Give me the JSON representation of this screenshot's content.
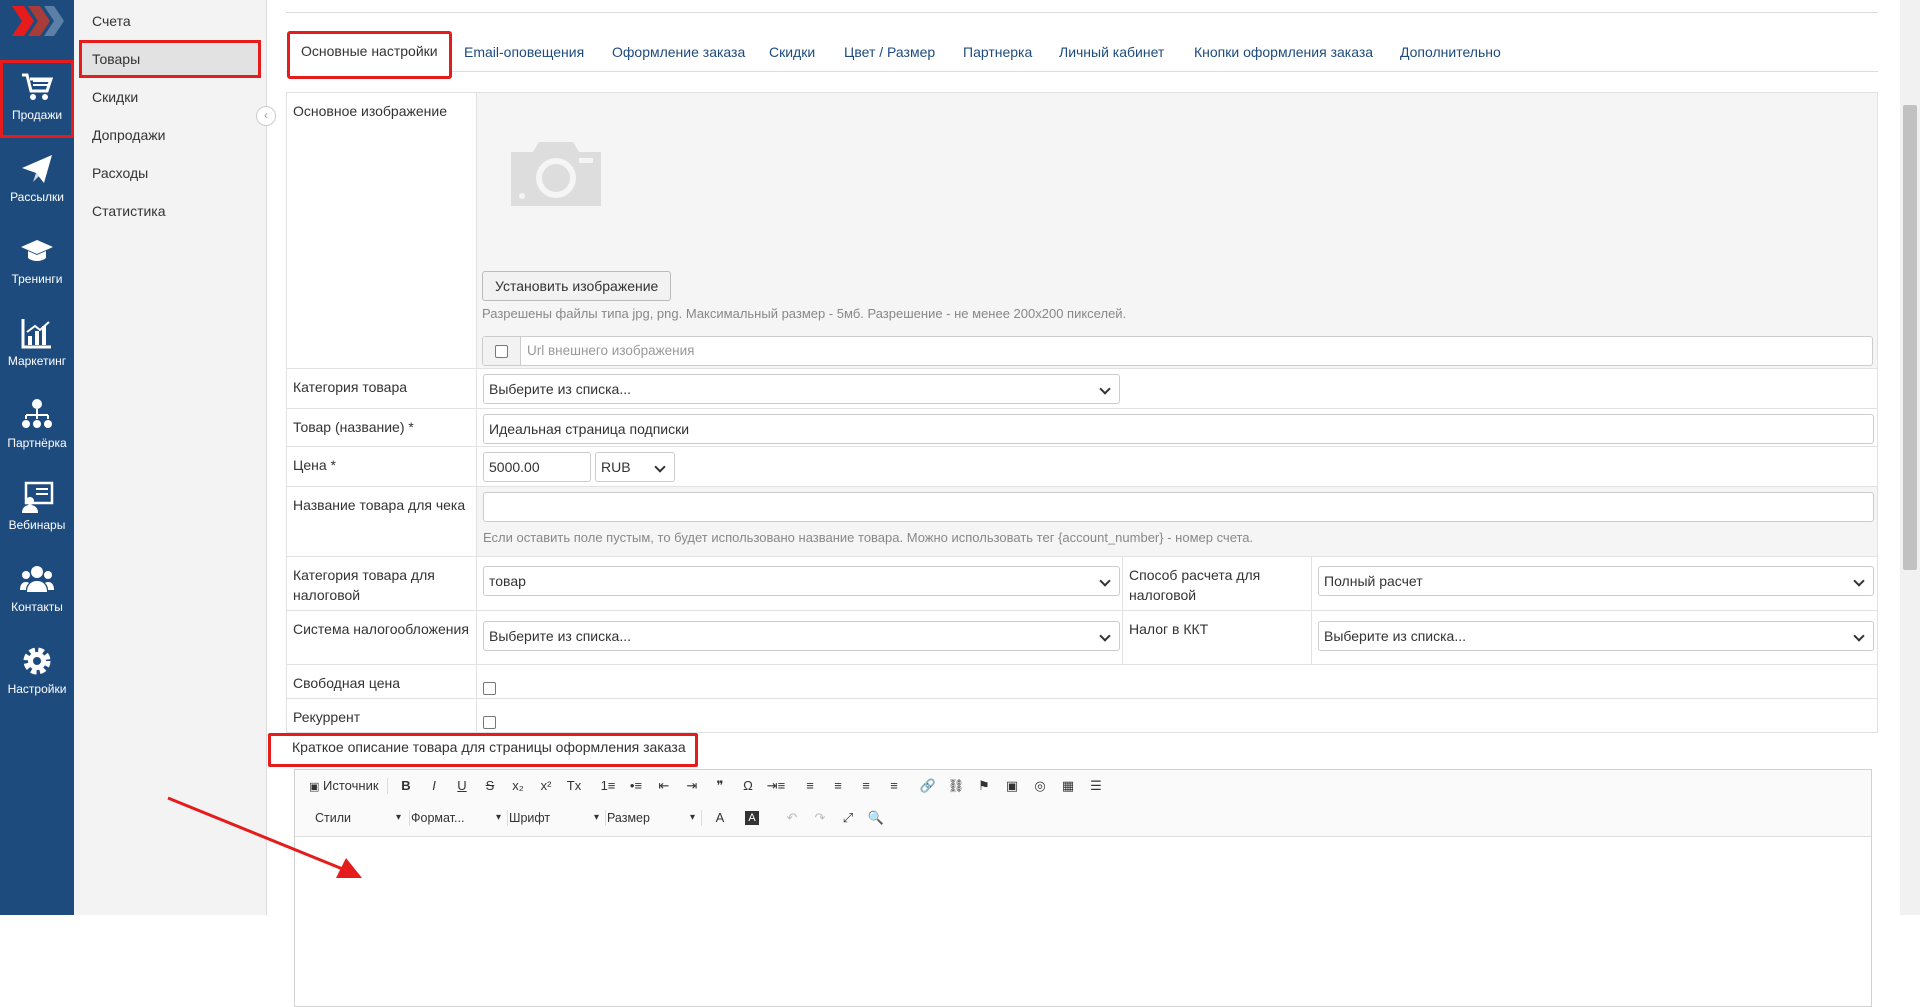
{
  "rail": {
    "items": [
      {
        "label": "Продажи",
        "icon": "cart-icon"
      },
      {
        "label": "Рассылки",
        "icon": "paper-plane-icon"
      },
      {
        "label": "Тренинги",
        "icon": "graduation-cap-icon"
      },
      {
        "label": "Маркетинг",
        "icon": "chart-icon"
      },
      {
        "label": "Партнёрка",
        "icon": "sitemap-icon"
      },
      {
        "label": "Вебинары",
        "icon": "webinar-icon"
      },
      {
        "label": "Контакты",
        "icon": "users-icon"
      },
      {
        "label": "Настройки",
        "icon": "gear-icon"
      }
    ]
  },
  "subnav": {
    "items": [
      "Счета",
      "Товары",
      "Скидки",
      "Допродажи",
      "Расходы",
      "Статистика"
    ]
  },
  "tabs": [
    "Основные настройки",
    "Email-оповещения",
    "Оформление заказа",
    "Скидки",
    "Цвет / Размер",
    "Партнерка",
    "Личный кабинет",
    "Кнопки оформления заказа",
    "Дополнительно"
  ],
  "form": {
    "image": {
      "label": "Основное изображение",
      "button": "Установить изображение",
      "hint": "Разрешены файлы типа jpg, png. Максимальный размер - 5мб. Разрешение - не менее 200x200 пикселей.",
      "url_placeholder": "Url внешнего изображения"
    },
    "category": {
      "label": "Категория товара",
      "value": "Выберите из списка..."
    },
    "name": {
      "label": "Товар (название) *",
      "value": "Идеальная страница подписки"
    },
    "price": {
      "label": "Цена *",
      "value": "5000.00",
      "currency": "RUB"
    },
    "receipt_name": {
      "label": "Название товара для чека",
      "value": "",
      "hint": "Если оставить поле пустым, то будет использовано название товара. Можно использовать тег {account_number} - номер счета."
    },
    "tax_category": {
      "label": "Категория товара для налоговой",
      "value": "товар"
    },
    "payment_method": {
      "label": "Способ расчета для налоговой",
      "value": "Полный расчет"
    },
    "tax_system": {
      "label": "Система налогообложения",
      "value": "Выберите из списка..."
    },
    "kkt_tax": {
      "label": "Налог в ККТ",
      "value": "Выберите из списка..."
    },
    "free_price": {
      "label": "Свободная цена"
    },
    "recurrent": {
      "label": "Рекуррент"
    },
    "short_desc": {
      "label": "Краткое описание товара для страницы оформления заказа"
    }
  },
  "editor": {
    "source": "Источник",
    "styles": "Стили",
    "format": "Формат...",
    "font": "Шрифт",
    "size": "Размер",
    "row1_icons": [
      "B",
      "I",
      "U",
      "S",
      "x₂",
      "x²",
      "Tx",
      "1≡",
      "•≡",
      "⇤",
      "⇥",
      "❞",
      "Ω",
      "⇥≡",
      "≡",
      "≡",
      "≡",
      "≡",
      "🔗",
      "⛓",
      "⚑",
      "▣",
      "◎",
      "▦",
      "☰"
    ],
    "row2_icons": [
      "A",
      "A",
      "↶",
      "↷",
      "⤢",
      "🔍"
    ]
  },
  "colors": {
    "rail": "#1e4b7e",
    "accent": "#e61b1b",
    "link": "#1e4b7e"
  }
}
